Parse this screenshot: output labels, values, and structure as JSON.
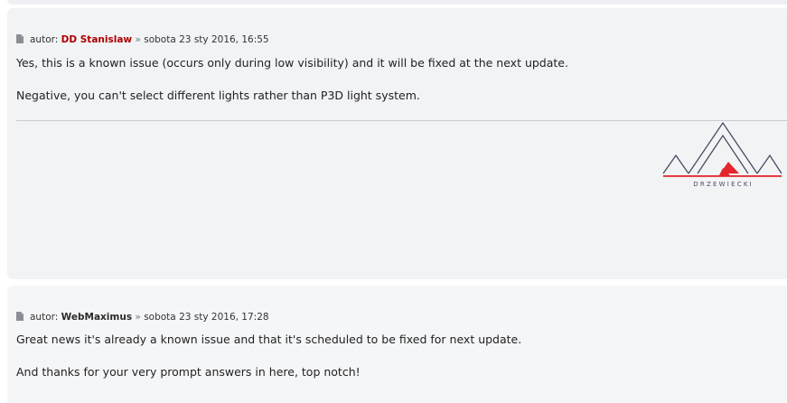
{
  "post1": {
    "author_prefix": "autor:",
    "author": "DD Stanislaw",
    "separator": "»",
    "date": "sobota 23 sty 2016, 16:55",
    "lines": [
      "Yes, this is a known issue (occurs only during low visibility) and it will be fixed at the next update.",
      "Negative, you can't select different lights rather than P3D light system."
    ],
    "signature": {
      "logo_text": "D R Z E W I E C K I",
      "accent_color": "#e3262b",
      "line_color": "#4a4a62"
    }
  },
  "post2": {
    "author_prefix": "autor:",
    "author": "WebMaximus",
    "separator": "»",
    "date": "sobota 23 sty 2016, 17:28",
    "lines": [
      "Great news it's already a known issue and that it's scheduled to be fixed for next update.",
      "And thanks for your very prompt answers in here, top notch!"
    ]
  },
  "colors": {
    "author_highlight": "#aa0000",
    "post_background": "#f3f4f6"
  },
  "icons": {
    "post_link": "document-icon"
  }
}
